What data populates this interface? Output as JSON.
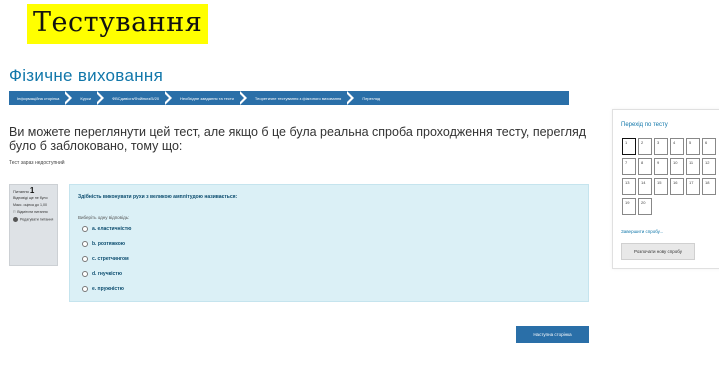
{
  "slide_title": "Тестування",
  "course_title": "Фізичне виховання",
  "breadcrumb": [
    "Інформаційна сторінка",
    "Курси",
    "ФВСдивісгз/Фойінкгз/5/20",
    "Необхідне завдання та тести",
    "Теоретичне тестування з фізичного виховання",
    "Перегляд"
  ],
  "notice": {
    "text": "Ви можете переглянути цей тест, але якщо б це була реальна спроба проходження тесту, перегляд було б заблоковано, тому що:",
    "sub": "Тест зараз недоступний"
  },
  "question_info": {
    "label": "Питання",
    "number": "1",
    "status": "Відповіді ще не було",
    "marks": "Макс. оцінка до 1,00",
    "flag": "Відмітити питання",
    "edit": "Редагувати питання"
  },
  "question": {
    "text": "Здібність виконувати рухи з великою амплітудою називається:",
    "prompt": "Виберіть одну відповідь:",
    "options": [
      "a. еластичністю",
      "b. розтяжкою",
      "c. стретчингом",
      "d. гнучкістю",
      "e. пружністю"
    ]
  },
  "next_button": "Наступна сторінка",
  "quiz_nav": {
    "title": "Перехід по тесту",
    "cells": [
      "1",
      "2",
      "3",
      "4",
      "5",
      "6",
      "7",
      "8",
      "9",
      "10",
      "11",
      "12",
      "13",
      "14",
      "15",
      "16",
      "17",
      "18",
      "19",
      "20"
    ],
    "current": "1",
    "finish_link": "Завершити спробу...",
    "new_attempt_button": "Розпочати нову спробу"
  },
  "colors": {
    "title_highlight": "#ffff00",
    "accent": "#2a6fa8",
    "link": "#1177aa",
    "question_bg": "#dbf0f6",
    "info_bg": "#dee2e6"
  }
}
